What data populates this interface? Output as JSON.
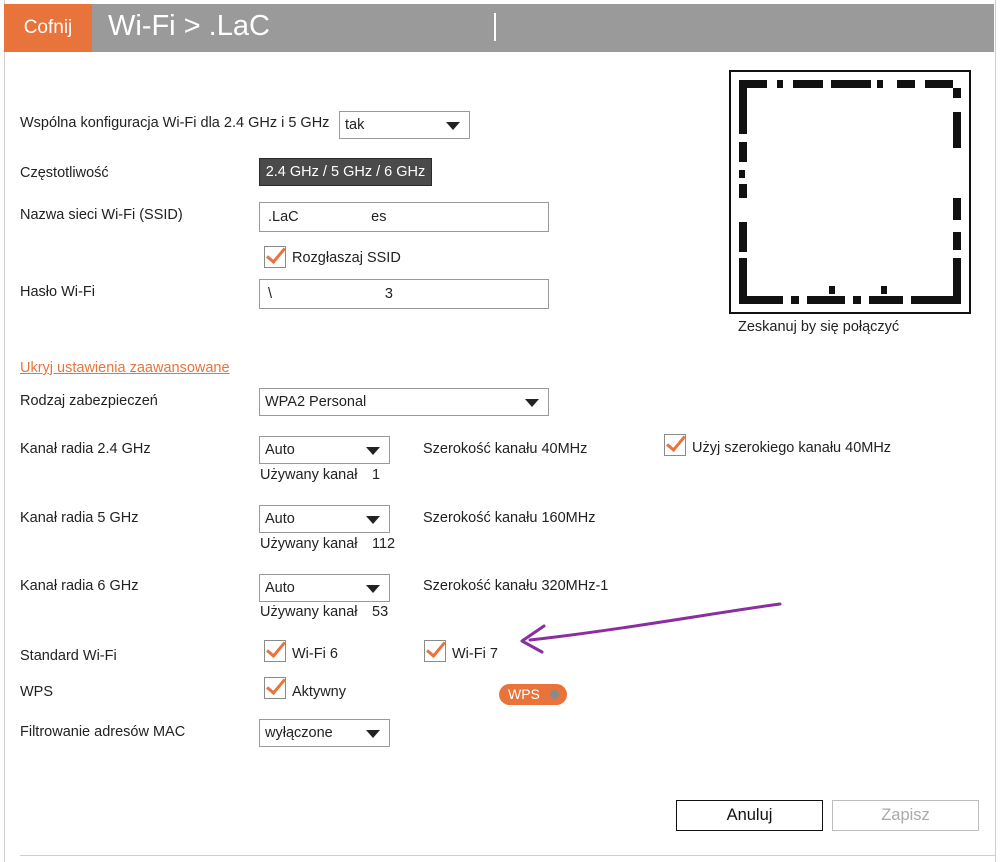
{
  "header": {
    "back_label": "Cofnij",
    "title": "Wi-Fi > .LaC"
  },
  "form": {
    "common_config": {
      "label": "Wspólna konfiguracja Wi-Fi dla 2.4 GHz i 5 GHz",
      "value": "tak"
    },
    "frequency": {
      "label": "Częstotliwość",
      "value": "2.4 GHz / 5 GHz / 6 GHz"
    },
    "ssid": {
      "label": "Nazwa sieci Wi-Fi (SSID)",
      "value": ".LaC                  es"
    },
    "broadcast_ssid": {
      "label": "Rozgłaszaj SSID",
      "checked": true
    },
    "password": {
      "label": "Hasło Wi-Fi",
      "value": "\\                            3"
    },
    "advanced_link": "Ukryj ustawienia zaawansowane",
    "security": {
      "label": "Rodzaj zabezpieczeń",
      "value": "WPA2 Personal"
    },
    "channel_24": {
      "label": "Kanał radia 2.4 GHz",
      "value": "Auto",
      "used_label": "Używany kanał",
      "used_value": "1",
      "width_text": "Szerokość kanału 40MHz",
      "wide_channel_label": "Użyj szerokiego kanału 40MHz",
      "wide_channel_checked": true
    },
    "channel_5": {
      "label": "Kanał radia 5 GHz",
      "value": "Auto",
      "used_label": "Używany kanał",
      "used_value": "112",
      "width_text": "Szerokość kanału 160MHz"
    },
    "channel_6": {
      "label": "Kanał radia 6 GHz",
      "value": "Auto",
      "used_label": "Używany kanał",
      "used_value": "53",
      "width_text": "Szerokość kanału 320MHz-1"
    },
    "wifi_standard": {
      "label": "Standard Wi-Fi",
      "wifi6_label": "Wi-Fi 6",
      "wifi6_checked": true,
      "wifi7_label": "Wi-Fi 7",
      "wifi7_checked": true
    },
    "wps": {
      "label": "WPS",
      "active_label": "Aktywny",
      "active_checked": true,
      "button_label": "WPS"
    },
    "mac_filter": {
      "label": "Filtrowanie adresów MAC",
      "value": "wyłączone"
    }
  },
  "qr": {
    "caption": "Zeskanuj by się połączyć"
  },
  "actions": {
    "cancel_label": "Anuluj",
    "save_label": "Zapisz"
  },
  "colors": {
    "accent": "#e8743b",
    "header_bg": "#9a9a9a",
    "badge_bg": "#4a4a4a",
    "annotation": "#8a2ea0"
  }
}
